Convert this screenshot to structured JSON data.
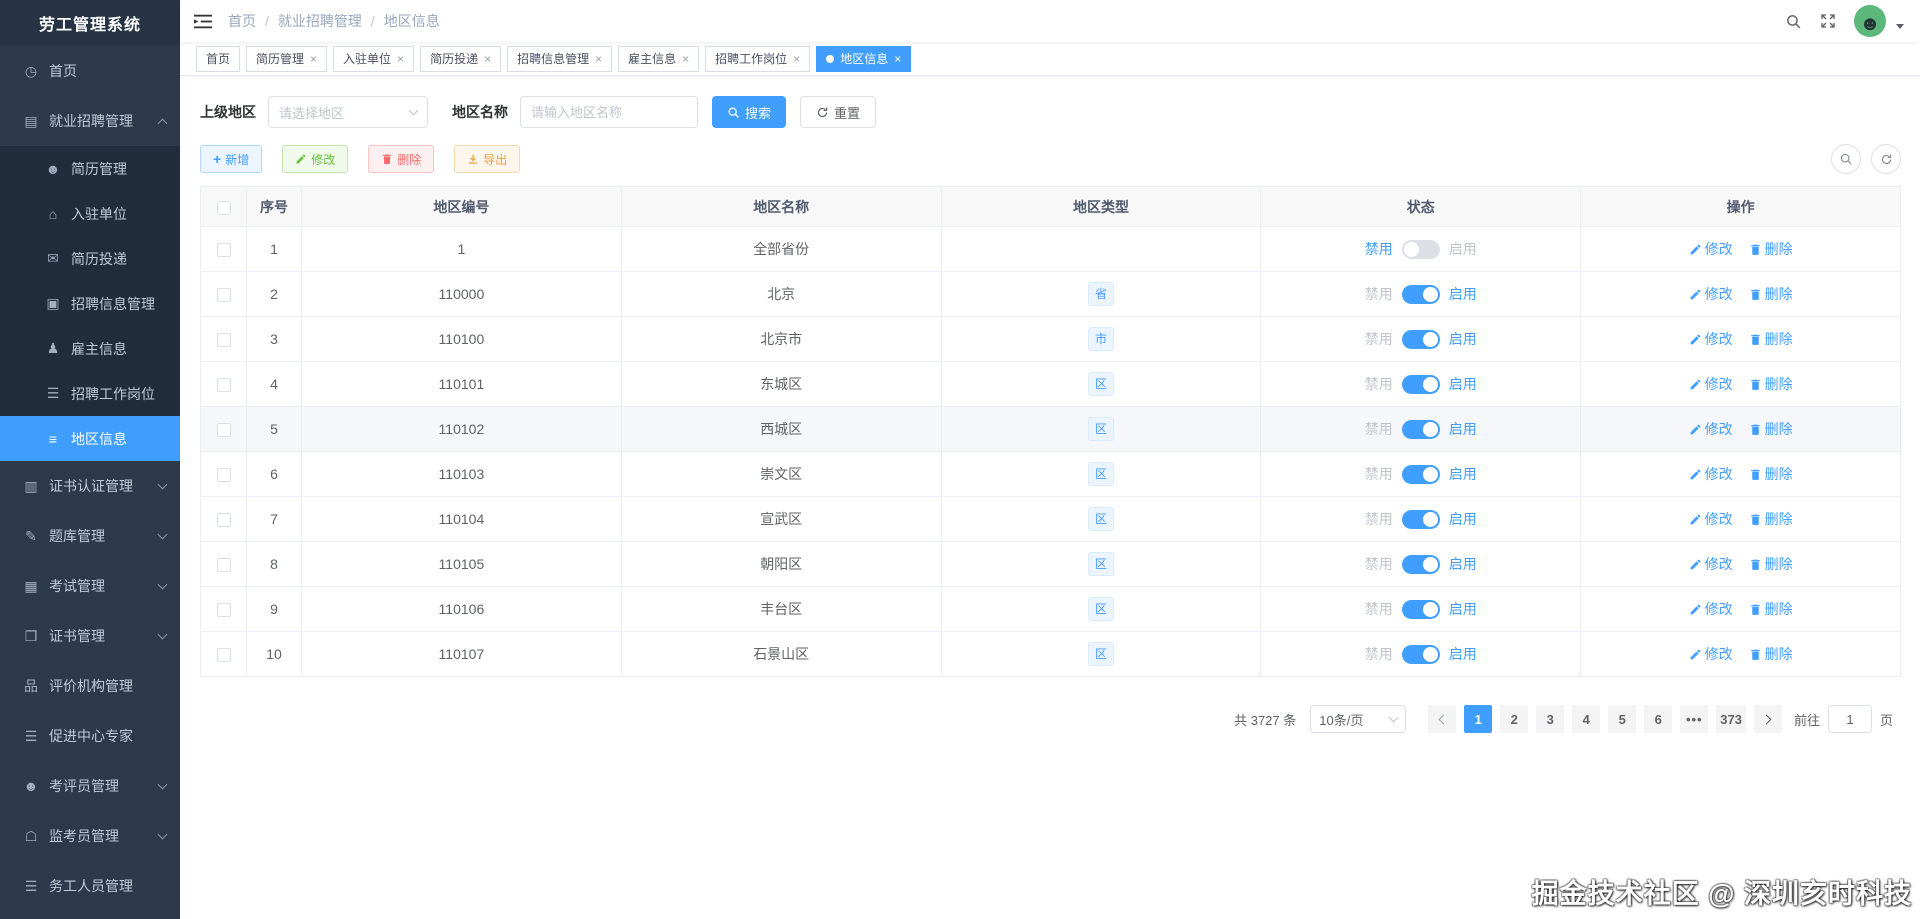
{
  "app": {
    "title": "劳工管理系统",
    "watermark": "掘金技术社区 @ 深圳亥时科技"
  },
  "navbar": {
    "breadcrumb": [
      "首页",
      "就业招聘管理",
      "地区信息"
    ]
  },
  "sidebar": {
    "items": [
      {
        "id": "home",
        "label": "首页",
        "icon": "dashboard-icon",
        "level": 1,
        "arrow": null,
        "active": false
      },
      {
        "id": "employment-recruitment",
        "label": "就业招聘管理",
        "icon": "recruitment-icon",
        "level": 1,
        "arrow": "up",
        "active": false
      },
      {
        "id": "resume-management",
        "label": "简历管理",
        "icon": "resume-icon",
        "level": 2,
        "arrow": null,
        "active": false
      },
      {
        "id": "settled-units",
        "label": "入驻单位",
        "icon": "company-icon",
        "level": 2,
        "arrow": null,
        "active": false
      },
      {
        "id": "resume-delivery",
        "label": "简历投递",
        "icon": "resume-send-icon",
        "level": 2,
        "arrow": null,
        "active": false
      },
      {
        "id": "recruitment-info",
        "label": "招聘信息管理",
        "icon": "recruit-info-icon",
        "level": 2,
        "arrow": null,
        "active": false
      },
      {
        "id": "employer-info",
        "label": "雇主信息",
        "icon": "employer-icon",
        "level": 2,
        "arrow": null,
        "active": false
      },
      {
        "id": "job-positions",
        "label": "招聘工作岗位",
        "icon": "job-list-icon",
        "level": 2,
        "arrow": null,
        "active": false
      },
      {
        "id": "region-info",
        "label": "地区信息",
        "icon": "region-list-icon",
        "level": 2,
        "arrow": null,
        "active": true
      },
      {
        "id": "certificate-auth",
        "label": "证书认证管理",
        "icon": "cert-auth-icon",
        "level": 1,
        "arrow": "down",
        "active": false
      },
      {
        "id": "question-bank",
        "label": "题库管理",
        "icon": "question-bank-icon",
        "level": 1,
        "arrow": "down",
        "active": false
      },
      {
        "id": "exam-management",
        "label": "考试管理",
        "icon": "exam-icon",
        "level": 1,
        "arrow": "down",
        "active": false
      },
      {
        "id": "certificate-management",
        "label": "证书管理",
        "icon": "certificate-icon",
        "level": 1,
        "arrow": "down",
        "active": false
      },
      {
        "id": "evaluation-org",
        "label": "评价机构管理",
        "icon": "org-tree-icon",
        "level": 1,
        "arrow": null,
        "active": false
      },
      {
        "id": "promotion-expert",
        "label": "促进中心专家",
        "icon": "expert-list-icon",
        "level": 1,
        "arrow": null,
        "active": false
      },
      {
        "id": "assessor-management",
        "label": "考评员管理",
        "icon": "assessor-icon",
        "level": 1,
        "arrow": "down",
        "active": false
      },
      {
        "id": "proctor-management",
        "label": "监考员管理",
        "icon": "proctor-icon",
        "level": 1,
        "arrow": "down",
        "active": false
      },
      {
        "id": "worker-management",
        "label": "务工人员管理",
        "icon": "worker-list-icon",
        "level": 1,
        "arrow": null,
        "active": false
      }
    ]
  },
  "tabs": [
    {
      "label": "首页",
      "closable": false,
      "active": false
    },
    {
      "label": "简历管理",
      "closable": true,
      "active": false
    },
    {
      "label": "入驻单位",
      "closable": true,
      "active": false
    },
    {
      "label": "简历投递",
      "closable": true,
      "active": false
    },
    {
      "label": "招聘信息管理",
      "closable": true,
      "active": false
    },
    {
      "label": "雇主信息",
      "closable": true,
      "active": false
    },
    {
      "label": "招聘工作岗位",
      "closable": true,
      "active": false
    },
    {
      "label": "地区信息",
      "closable": true,
      "active": true
    }
  ],
  "filters": {
    "parent_label": "上级地区",
    "parent_placeholder": "请选择地区",
    "name_label": "地区名称",
    "name_placeholder": "请输入地区名称",
    "search_label": "搜索",
    "reset_label": "重置"
  },
  "toolbar": {
    "add_label": "新增",
    "edit_label": "修改",
    "delete_label": "删除",
    "export_label": "导出"
  },
  "table": {
    "columns": [
      "序号",
      "地区编号",
      "地区名称",
      "地区类型",
      "状态",
      "操作"
    ],
    "status_off_label": "禁用",
    "status_on_label": "启用",
    "edit_label": "修改",
    "delete_label": "删除",
    "rows": [
      {
        "index": "1",
        "code": "1",
        "name": "全部省份",
        "type": "",
        "enabled": false,
        "highlighted": false
      },
      {
        "index": "2",
        "code": "110000",
        "name": "北京",
        "type": "省",
        "enabled": true,
        "highlighted": false
      },
      {
        "index": "3",
        "code": "110100",
        "name": "北京市",
        "type": "市",
        "enabled": true,
        "highlighted": false
      },
      {
        "index": "4",
        "code": "110101",
        "name": "东城区",
        "type": "区",
        "enabled": true,
        "highlighted": false
      },
      {
        "index": "5",
        "code": "110102",
        "name": "西城区",
        "type": "区",
        "enabled": true,
        "highlighted": true
      },
      {
        "index": "6",
        "code": "110103",
        "name": "崇文区",
        "type": "区",
        "enabled": true,
        "highlighted": false
      },
      {
        "index": "7",
        "code": "110104",
        "name": "宣武区",
        "type": "区",
        "enabled": true,
        "highlighted": false
      },
      {
        "index": "8",
        "code": "110105",
        "name": "朝阳区",
        "type": "区",
        "enabled": true,
        "highlighted": false
      },
      {
        "index": "9",
        "code": "110106",
        "name": "丰台区",
        "type": "区",
        "enabled": true,
        "highlighted": false
      },
      {
        "index": "10",
        "code": "110107",
        "name": "石景山区",
        "type": "区",
        "enabled": true,
        "highlighted": false
      }
    ]
  },
  "pagination": {
    "total_label": "共 3727 条",
    "page_size": "10条/页",
    "pages": [
      "1",
      "2",
      "3",
      "4",
      "5",
      "6",
      "•••",
      "373"
    ],
    "active_page": "1",
    "goto_label": "前往",
    "goto_value": "1",
    "page_unit_label": "页"
  },
  "colors": {
    "primary": "#409eff",
    "success": "#67c23a",
    "danger": "#f56c6c",
    "warning": "#e6a23c",
    "sidebar_bg": "#2d3a4b",
    "submenu_bg": "#1f2d3d",
    "table_header_bg": "#f8f8f9"
  }
}
